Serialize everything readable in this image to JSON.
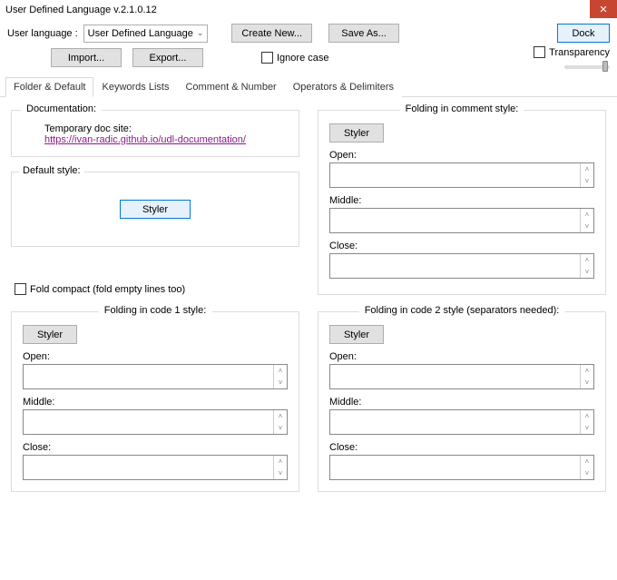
{
  "window": {
    "title": "User Defined Language v.2.1.0.12"
  },
  "top": {
    "userLanguageLabel": "User language :",
    "selectedLanguage": "User Defined Language",
    "createNew": "Create New...",
    "saveAs": "Save As...",
    "dock": "Dock",
    "import": "Import...",
    "export": "Export...",
    "ignoreCase": "Ignore case",
    "transparency": "Transparency"
  },
  "tabs": {
    "folderDefault": "Folder & Default",
    "keywordsLists": "Keywords Lists",
    "commentNumber": "Comment & Number",
    "operatorsDelimiters": "Operators & Delimiters"
  },
  "docGroup": {
    "legend": "Documentation:",
    "tempLabel": "Temporary doc site:",
    "link": "https://ivan-radic.github.io/udl-documentation/"
  },
  "defaultStyle": {
    "legend": "Default style:",
    "styler": "Styler"
  },
  "foldCompact": "Fold compact (fold empty lines too)",
  "commentFold": {
    "legend": "Folding in comment style:",
    "styler": "Styler",
    "open": "Open:",
    "middle": "Middle:",
    "close": "Close:"
  },
  "code1Fold": {
    "legend": "Folding in code 1 style:",
    "styler": "Styler",
    "open": "Open:",
    "middle": "Middle:",
    "close": "Close:"
  },
  "code2Fold": {
    "legend": "Folding in code 2 style (separators needed):",
    "styler": "Styler",
    "open": "Open:",
    "middle": "Middle:",
    "close": "Close:"
  }
}
